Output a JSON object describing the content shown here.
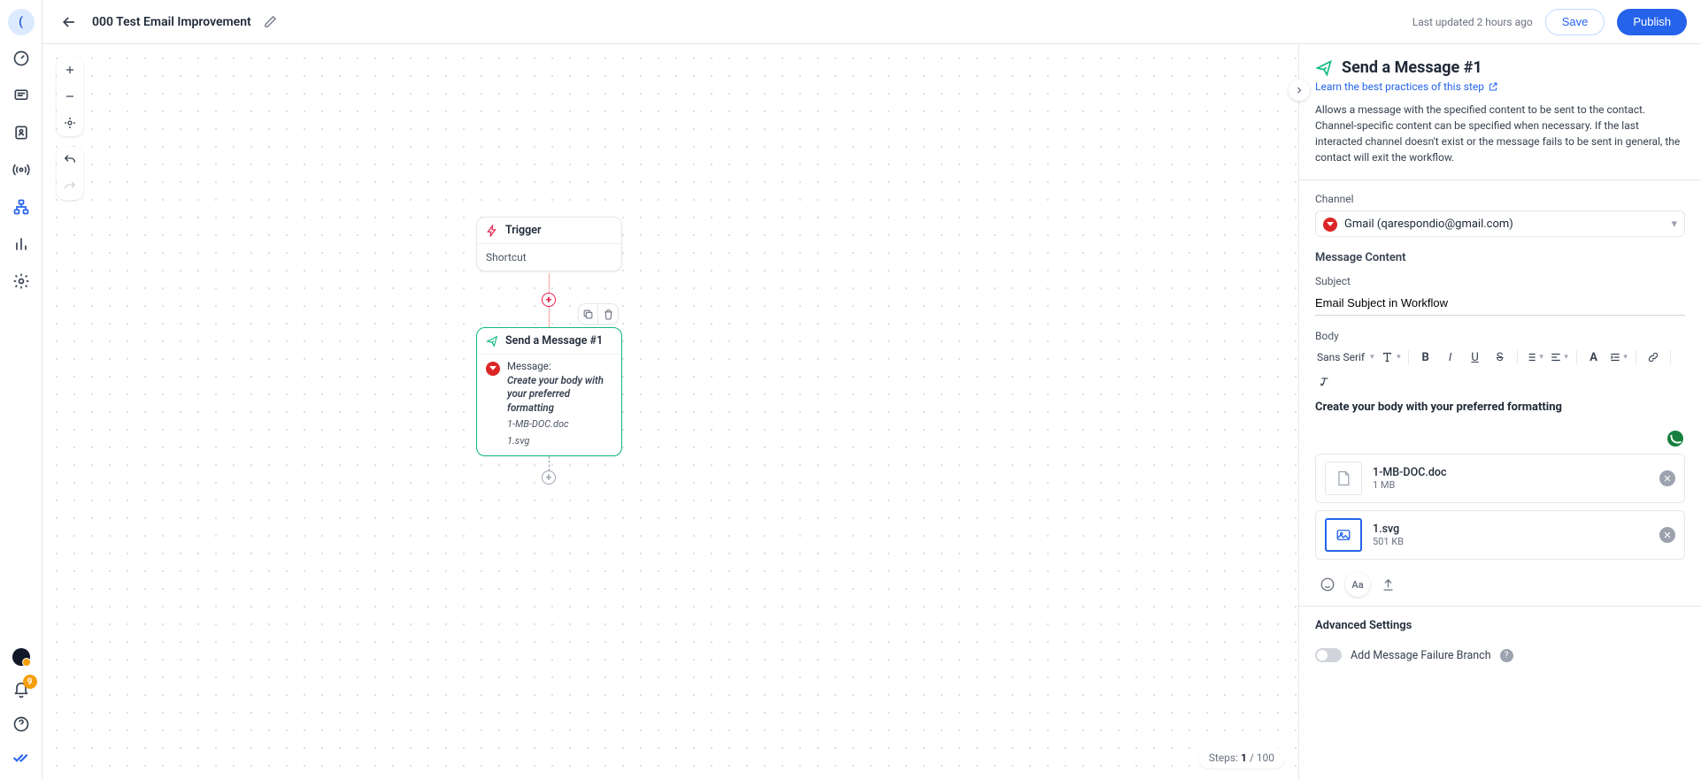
{
  "rail": {
    "avatar_letter": "(",
    "notifications": "9"
  },
  "header": {
    "title": "000 Test Email Improvement",
    "last_updated": "Last updated 2 hours ago",
    "save": "Save",
    "publish": "Publish"
  },
  "canvas": {
    "steps_label": "Steps:",
    "steps_current": "1",
    "steps_sep": "/",
    "steps_max": "100",
    "trigger": {
      "title": "Trigger",
      "subtitle": "Shortcut"
    },
    "send_node": {
      "title": "Send a Message #1",
      "msg_label": "Message:",
      "msg_line1": "Create your body with",
      "msg_line2": "your preferred formatting",
      "att1": "1-MB-DOC.doc",
      "att2": "1.svg"
    }
  },
  "panel": {
    "title": "Send a Message #1",
    "learn": "Learn the best practices of this step",
    "description": "Allows a message with the specified content to be sent to the contact. Channel-specific content can be specified when necessary. If the last interacted channel doesn't exist or the message fails to be sent in general, the contact will exit the workflow.",
    "channel_label": "Channel",
    "channel_value": "Gmail (qarespondio@gmail.com)",
    "mc_title": "Message Content",
    "subject_label": "Subject",
    "subject_value": "Email Subject in Workflow",
    "body_label": "Body",
    "font_name": "Sans Serif",
    "body_text": "Create your body with your preferred formatting",
    "att": [
      {
        "name": "1-MB-DOC.doc",
        "size": "1 MB"
      },
      {
        "name": "1.svg",
        "size": "501 KB"
      }
    ],
    "var_btn": "Aa",
    "adv_title": "Advanced Settings",
    "fail_branch": "Add Message Failure Branch"
  }
}
